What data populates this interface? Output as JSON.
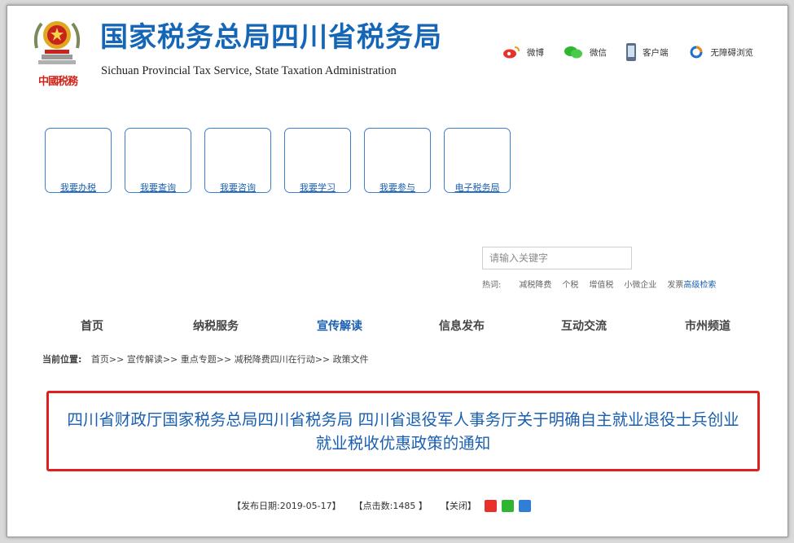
{
  "header": {
    "title_cn": "国家税务总局四川省税务局",
    "title_en": "Sichuan Provincial Tax Service, State Taxation Administration",
    "seal_text": "中國税務"
  },
  "toplinks": [
    {
      "label": "微博",
      "icon": "weibo-icon"
    },
    {
      "label": "微信",
      "icon": "wechat-icon"
    },
    {
      "label": "客户端",
      "icon": "mobile-icon"
    },
    {
      "label": "无障碍浏览",
      "icon": "accessibility-icon"
    }
  ],
  "services": [
    "我要办税",
    "我要查询",
    "我要咨询",
    "我要学习",
    "我要参与",
    "电子税务局"
  ],
  "search": {
    "placeholder": "请输入关键字",
    "hot_label": "热词:",
    "hot_words": [
      "减税降费",
      "个税",
      "增值税",
      "小微企业",
      "发票"
    ],
    "advanced": "高级检索"
  },
  "nav": {
    "items": [
      "首页",
      "纳税服务",
      "宣传解读",
      "信息发布",
      "互动交流",
      "市州频道"
    ],
    "active_index": 2
  },
  "breadcrumb": {
    "label": "当前位置:",
    "items": [
      "首页",
      "宣传解读",
      "重点专题",
      "减税降费四川在行动",
      "政策文件"
    ]
  },
  "article": {
    "title": "四川省财政厅国家税务总局四川省税务局 四川省退役军人事务厅关于明确自主就业退役士兵创业就业税收优惠政策的通知",
    "date_label": "【发布日期:",
    "date": "2019-05-17】",
    "clicks_label": "【点击数:",
    "clicks": "1485 】",
    "close_label": "【关闭】"
  },
  "colors": {
    "brand_blue": "#1666b8",
    "link_blue": "#1a5fb0",
    "highlight_red": "#e21f1f"
  }
}
